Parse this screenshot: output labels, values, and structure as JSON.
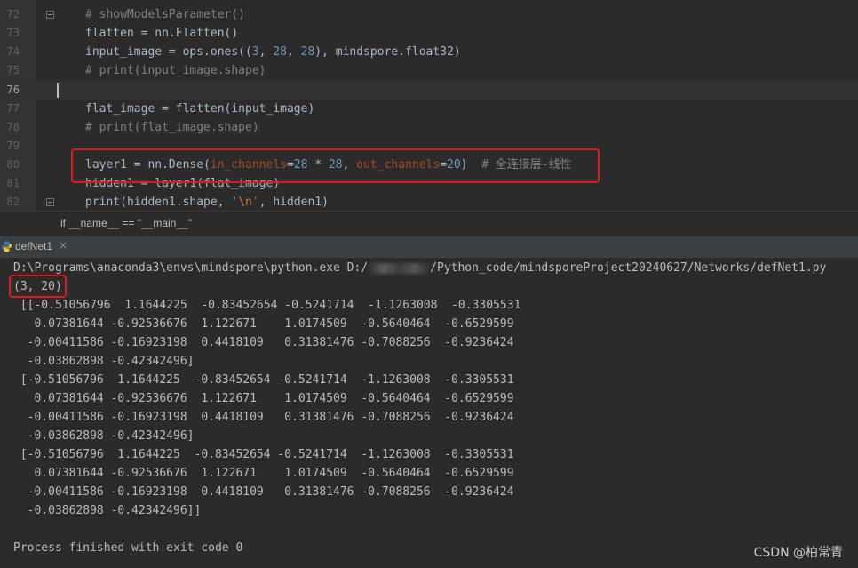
{
  "editor": {
    "lines": [
      {
        "num": "72",
        "text": "# showModelsParameter()"
      },
      {
        "num": "73",
        "text": "flatten = nn.Flatten()"
      },
      {
        "num": "74",
        "text": "input_image = ops.ones((3, 28, 28), mindspore.float32)"
      },
      {
        "num": "75",
        "text": "# print(input_image.shape)"
      },
      {
        "num": "76",
        "text": ""
      },
      {
        "num": "77",
        "text": "flat_image = flatten(input_image)"
      },
      {
        "num": "78",
        "text": "# print(flat_image.shape)"
      },
      {
        "num": "79",
        "text": ""
      },
      {
        "num": "80",
        "text": "layer1 = nn.Dense(in_channels=28 * 28, out_channels=20)  # 全连接层-线性"
      },
      {
        "num": "81",
        "text": "hidden1 = layer1(flat_image)"
      },
      {
        "num": "82",
        "text": "print(hidden1.shape, '\\n', hidden1)"
      }
    ],
    "tokens": {
      "l72": "# showModelsParameter()",
      "l73": "flatten = nn.Flatten()",
      "l74a": "input_image = ops.ones((",
      "l74n1": "3",
      "l74c1": ", ",
      "l74n2": "28",
      "l74c2": ", ",
      "l74n3": "28",
      "l74b": "), mindspore.float32)",
      "l75": "# print(input_image.shape)",
      "l77": "flat_image = flatten(input_image)",
      "l78": "# print(flat_image.shape)",
      "l80a": "layer1 = nn.Dense(",
      "l80p1": "in_channels",
      "l80eq1": "=",
      "l80n1": "28",
      "l80m": " * ",
      "l80n2": "28",
      "l80c": ", ",
      "l80p2": "out_channels",
      "l80eq2": "=",
      "l80n3": "20",
      "l80b": ")  ",
      "l80cm": "# 全连接层-线性",
      "l81": "hidden1 = layer1(flat_image)",
      "l82a": "print(hidden1.shape, ",
      "l82q1": "'",
      "l82esc": "\\n",
      "l82q2": "'",
      "l82b": ", hidden1)"
    }
  },
  "breadcrumb": {
    "text": "if __name__ == \"__main__\""
  },
  "run_tab": {
    "title": "defNet1",
    "close": "×"
  },
  "console": {
    "cmd_prefix": "D:\\Programs\\anaconda3\\envs\\mindspore\\python.exe D:/",
    "cmd_suffix": "/Python_code/mindsporeProject20240627/Networks/defNet1.py",
    "lines": [
      "(3, 20)",
      " [[-0.51056796  1.1644225  -0.83452654 -0.5241714  -1.1263008  -0.3305531",
      "   0.07381644 -0.92536676  1.122671    1.0174509  -0.5640464  -0.6529599",
      "  -0.00411586 -0.16923198  0.4418109   0.31381476 -0.7088256  -0.9236424",
      "  -0.03862898 -0.42342496]",
      " [-0.51056796  1.1644225  -0.83452654 -0.5241714  -1.1263008  -0.3305531",
      "   0.07381644 -0.92536676  1.122671    1.0174509  -0.5640464  -0.6529599",
      "  -0.00411586 -0.16923198  0.4418109   0.31381476 -0.7088256  -0.9236424",
      "  -0.03862898 -0.42342496]",
      " [-0.51056796  1.1644225  -0.83452654 -0.5241714  -1.1263008  -0.3305531",
      "   0.07381644 -0.92536676  1.122671    1.0174509  -0.5640464  -0.6529599",
      "  -0.00411586 -0.16923198  0.4418109   0.31381476 -0.7088256  -0.9236424",
      "  -0.03862898 -0.42342496]]",
      "",
      "Process finished with exit code 0"
    ]
  },
  "watermark": "CSDN @柏常青",
  "colors": {
    "editor_bg": "#2b2b2b",
    "gutter_bg": "#313335",
    "highlight_box": "#e0191b",
    "comment": "#808080",
    "number": "#6897bb",
    "param_name": "#aa4926"
  }
}
